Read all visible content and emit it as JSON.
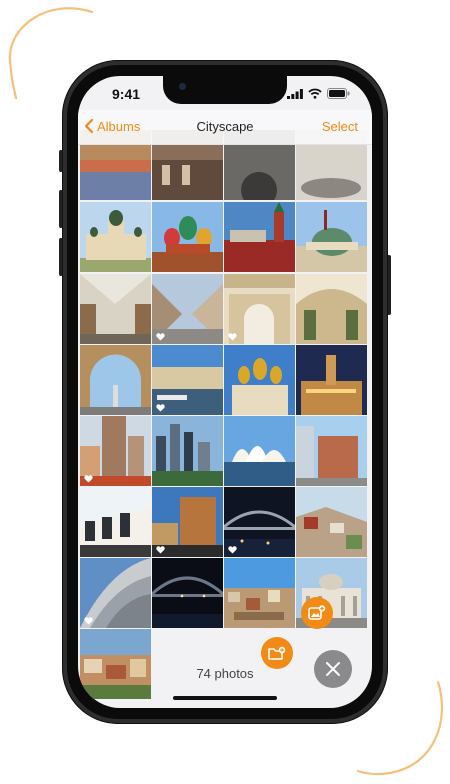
{
  "status": {
    "time": "9:41"
  },
  "navbar": {
    "back_label": "Albums",
    "title": "Cityscape",
    "select_label": "Select"
  },
  "footer": {
    "photo_count": "74 photos"
  },
  "colors": {
    "accent": "#f28a16",
    "fab_close": "#8a8a8c"
  },
  "icons": {
    "back": "chevron-left-icon",
    "signal": "cellular-signal-icon",
    "wifi": "wifi-icon",
    "battery": "battery-icon",
    "favorite": "heart-icon",
    "add_photo": "add-photo-icon",
    "add_folder": "add-folder-icon",
    "close": "close-icon"
  },
  "photos": [
    {
      "subject": "rooftops",
      "favorite": false
    },
    {
      "subject": "rooftops",
      "favorite": true
    },
    {
      "subject": "hall interior",
      "favorite": false
    },
    {
      "subject": "dome interior",
      "favorite": true
    },
    {
      "subject": "orthodox church",
      "favorite": false
    },
    {
      "subject": "st basil's cathedral",
      "favorite": false
    },
    {
      "subject": "kremlin wall",
      "favorite": false
    },
    {
      "subject": "kremlin palace",
      "favorite": false
    },
    {
      "subject": "shopping gallery",
      "favorite": false
    },
    {
      "subject": "pedestrian street",
      "favorite": true
    },
    {
      "subject": "palace courtyard",
      "favorite": true
    },
    {
      "subject": "arcade street",
      "favorite": false
    },
    {
      "subject": "triumphal arch",
      "favorite": false
    },
    {
      "subject": "canal view",
      "favorite": true
    },
    {
      "subject": "golden domes",
      "favorite": false
    },
    {
      "subject": "cathedral at dusk",
      "favorite": false
    },
    {
      "subject": "tower blocks",
      "favorite": true
    },
    {
      "subject": "city skyline",
      "favorite": false
    },
    {
      "subject": "opera house",
      "favorite": false
    },
    {
      "subject": "colonial building",
      "favorite": false
    },
    {
      "subject": "terrace houses",
      "favorite": false
    },
    {
      "subject": "modern towers",
      "favorite": true
    },
    {
      "subject": "harbour bridge",
      "favorite": true
    },
    {
      "subject": "hillside rooftops",
      "favorite": false
    },
    {
      "subject": "curved facade",
      "favorite": true
    },
    {
      "subject": "bridge at night",
      "favorite": false
    },
    {
      "subject": "hilltop town",
      "favorite": false
    },
    {
      "subject": "colonnade",
      "favorite": false
    },
    {
      "subject": "old town aerial",
      "favorite": false
    }
  ]
}
